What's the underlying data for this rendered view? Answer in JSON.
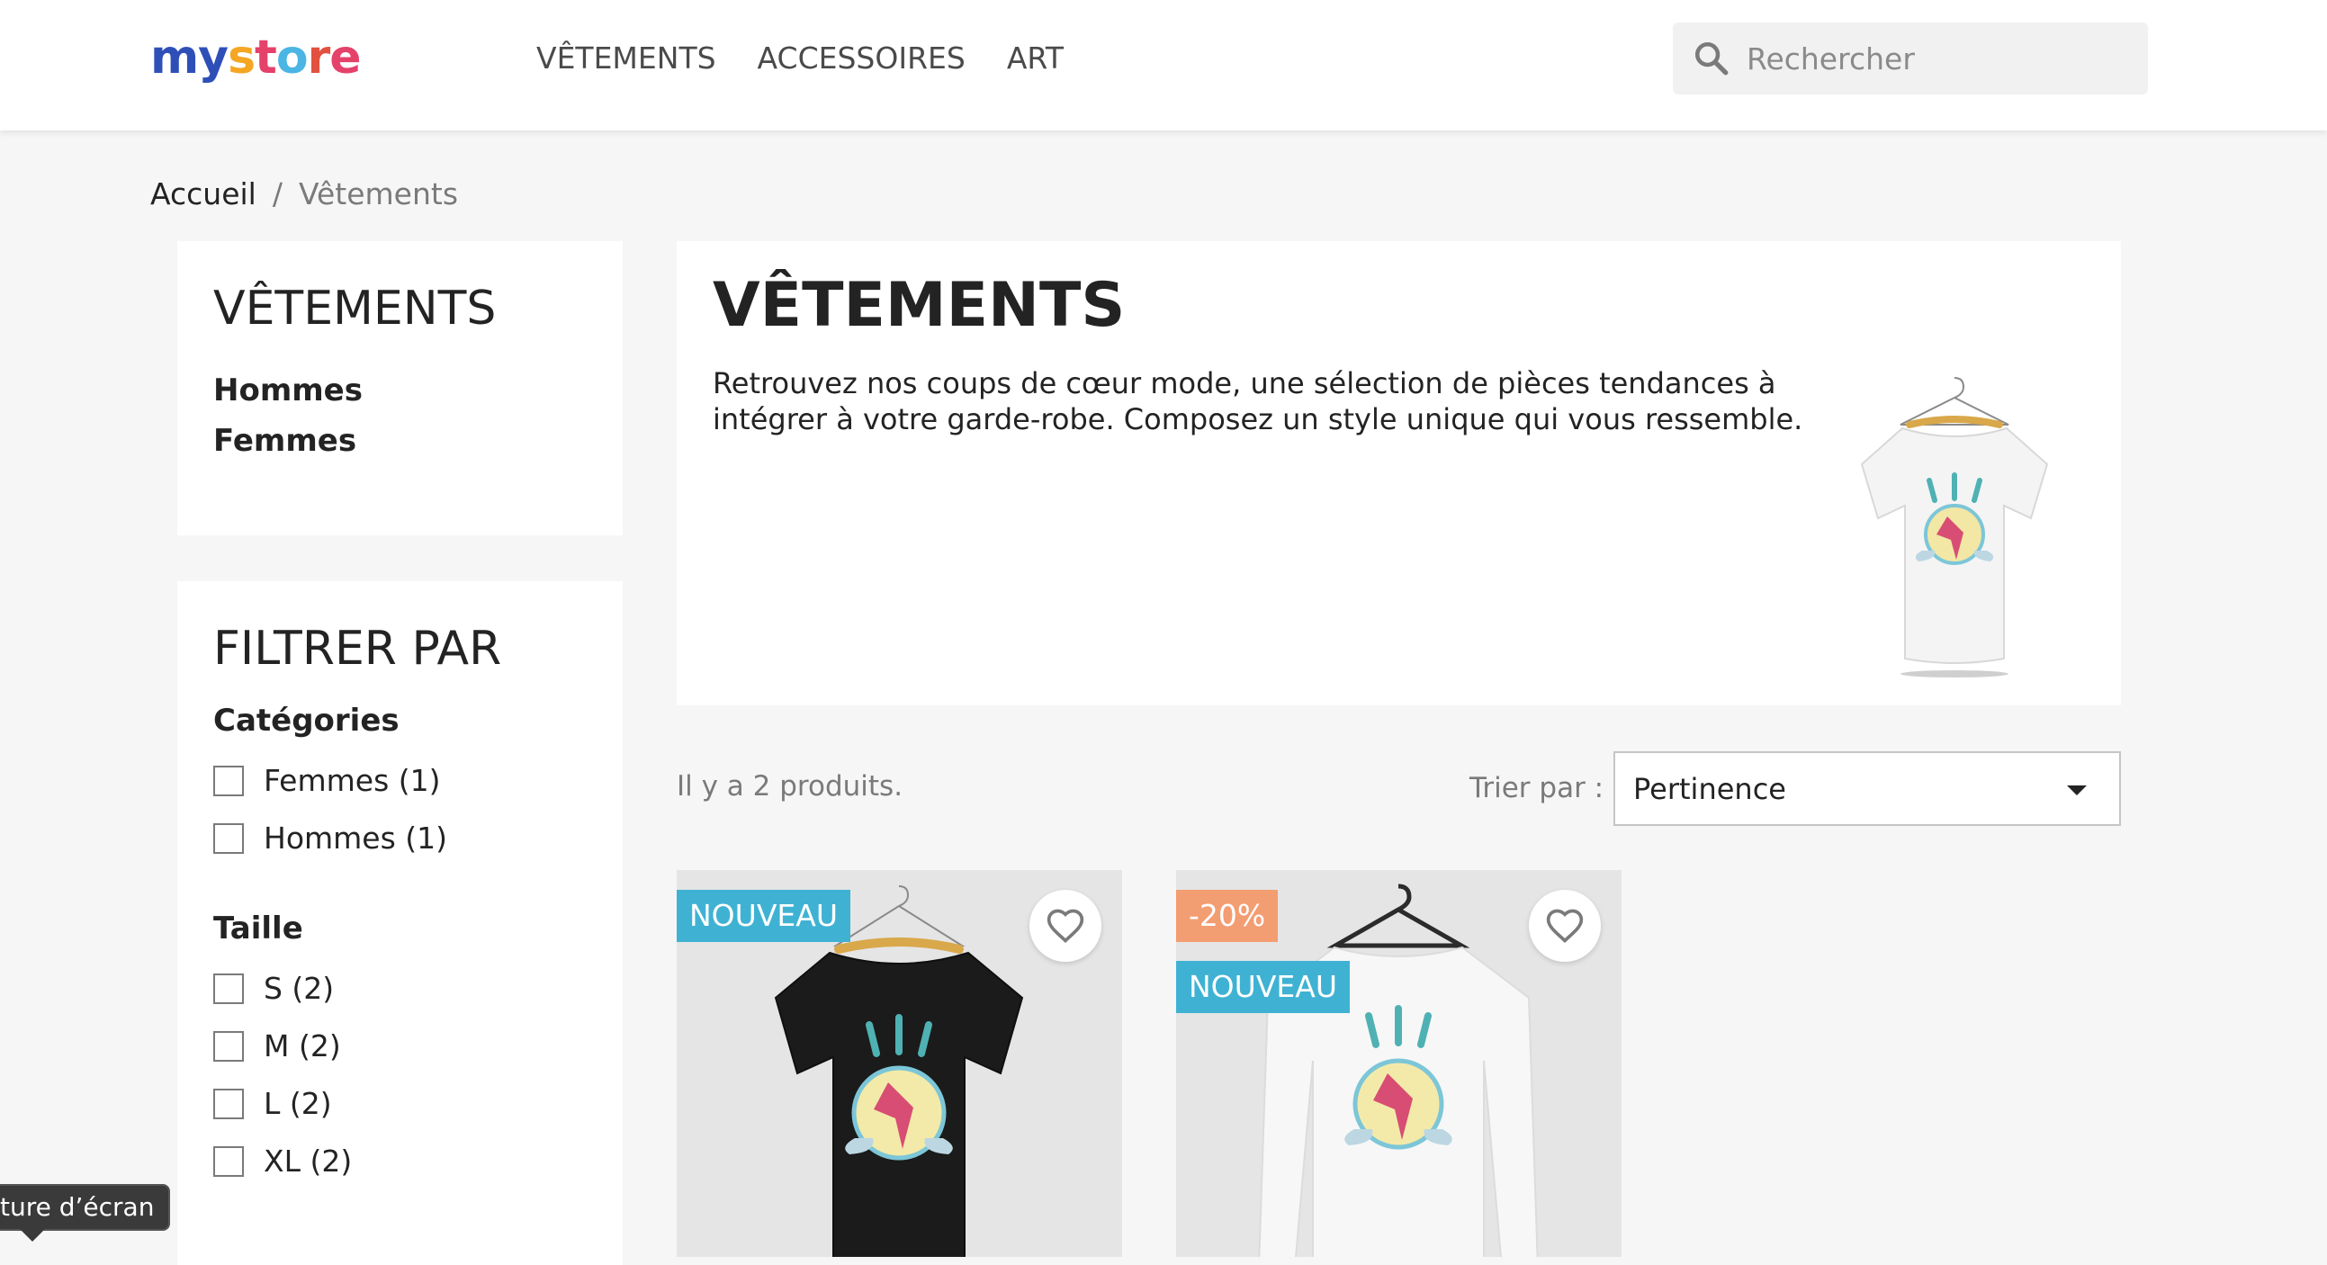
{
  "header": {
    "logo": [
      "my",
      " ",
      "s",
      "t",
      "o",
      "r",
      "e"
    ],
    "nav": [
      "VÊTEMENTS",
      "ACCESSOIRES",
      "ART"
    ],
    "search_placeholder": "Rechercher"
  },
  "breadcrumb": {
    "home": "Accueil",
    "separator": "/",
    "current": "Vêtements"
  },
  "sidebar": {
    "category_title": "VÊTEMENTS",
    "category_links": [
      "Hommes",
      "Femmes"
    ],
    "filter_title": "FILTRER PAR",
    "facets": {
      "categories_title": "Catégories",
      "categories": [
        "Femmes (1)",
        "Hommes (1)"
      ],
      "size_title": "Taille",
      "sizes": [
        "S (2)",
        "M (2)",
        "L (2)",
        "XL (2)"
      ]
    }
  },
  "tooltip": "ture d’écran",
  "category": {
    "title": "VÊTEMENTS",
    "description": "Retrouvez nos coups de cœur mode, une sélection de pièces tendances à intégrer à votre garde-robe. Composez un style unique qui vous ressemble."
  },
  "toolbar": {
    "count": "Il y a 2 produits.",
    "sort_label": "Trier par :",
    "sort_value": "Pertinence"
  },
  "products": [
    {
      "badges": [
        "NOUVEAU"
      ],
      "color": "black-tshirt"
    },
    {
      "badges": [
        "-20%",
        "NOUVEAU"
      ],
      "color": "white-sweater"
    }
  ],
  "colors": {
    "badge_new": "#3fb2d3",
    "badge_discount": "#f39d72"
  }
}
